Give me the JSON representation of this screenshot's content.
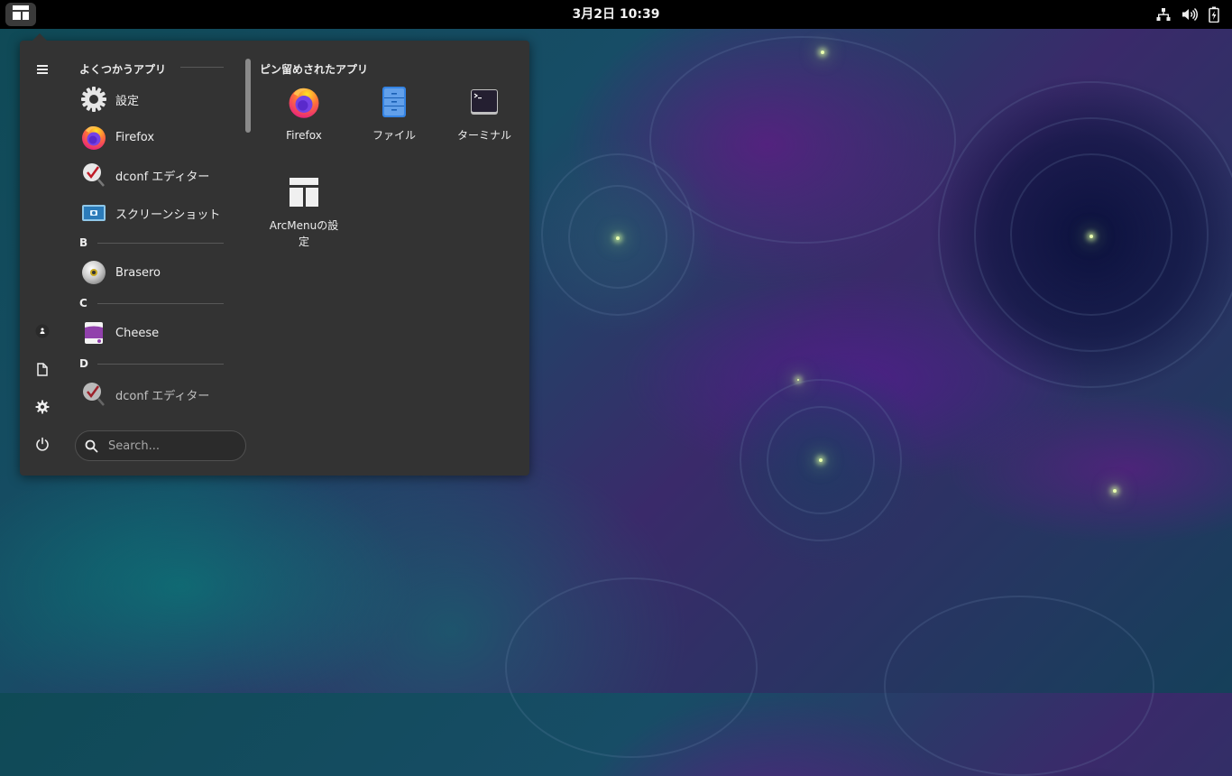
{
  "topbar": {
    "clock": "3月2日  10:39",
    "activities_icon": "arcmenu-icon",
    "tray_icons": [
      "network-icon",
      "volume-icon",
      "battery-icon"
    ]
  },
  "menu": {
    "sidebar_icons": [
      "hamburger-icon",
      "user-icon",
      "document-icon",
      "gear-icon",
      "power-icon"
    ],
    "frequent": {
      "title": "よくつかうアプリ",
      "items": [
        {
          "label": "設定",
          "icon": "settings-gear-icon"
        },
        {
          "label": "Firefox",
          "icon": "firefox-icon"
        },
        {
          "label": "dconf エディター",
          "icon": "dconf-editor-icon"
        },
        {
          "label": "スクリーンショット",
          "icon": "screenshot-icon"
        }
      ]
    },
    "groups": [
      {
        "letter": "B",
        "items": [
          {
            "label": "Brasero",
            "icon": "brasero-disc-icon"
          }
        ]
      },
      {
        "letter": "C",
        "items": [
          {
            "label": "Cheese",
            "icon": "cheese-icon"
          }
        ]
      },
      {
        "letter": "D",
        "items": [
          {
            "label": "dconf エディター",
            "icon": "dconf-editor-icon"
          }
        ]
      }
    ],
    "pinned": {
      "title": "ピン留めされたアプリ",
      "items": [
        {
          "label": "Firefox",
          "icon": "firefox-icon"
        },
        {
          "label": "ファイル",
          "icon": "files-icon"
        },
        {
          "label": "ターミナル",
          "icon": "terminal-icon"
        },
        {
          "label": "ArcMenuの設定",
          "icon": "arcmenu-settings-icon"
        }
      ]
    },
    "search": {
      "placeholder": "Search..."
    }
  },
  "colors": {
    "topbar": "#000000",
    "menu_bg": "#333333",
    "firefox_orange": "#ff7139",
    "files_blue": "#3584e4"
  }
}
